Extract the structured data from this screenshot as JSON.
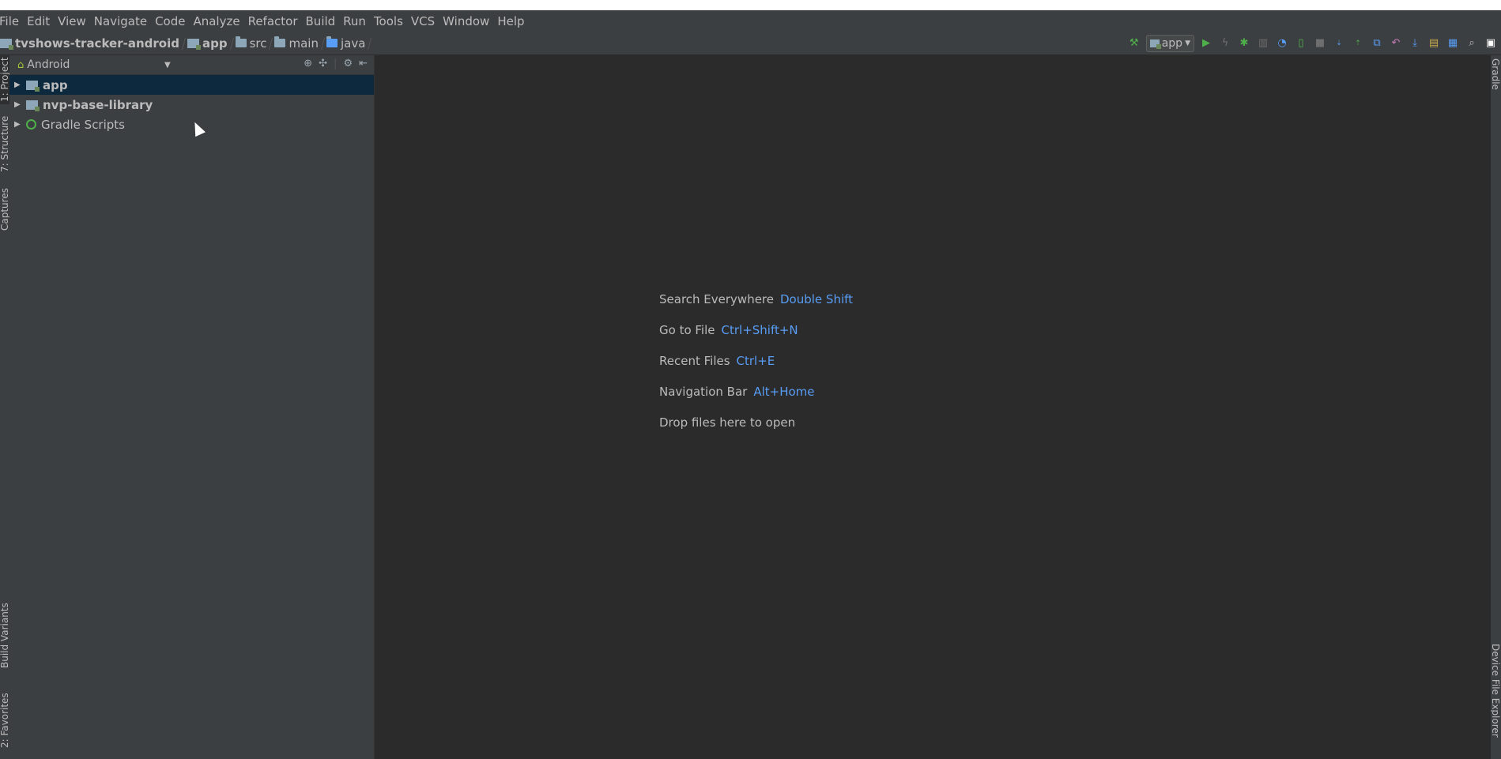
{
  "menu": [
    "File",
    "Edit",
    "View",
    "Navigate",
    "Code",
    "Analyze",
    "Refactor",
    "Build",
    "Run",
    "Tools",
    "VCS",
    "Window",
    "Help"
  ],
  "breadcrumbs": [
    "tvshows-tracker-android",
    "app",
    "src",
    "main",
    "java"
  ],
  "toolbar": {
    "run_config": "app"
  },
  "project_panel": {
    "view_mode": "Android",
    "tree": [
      {
        "label": "app",
        "bold": true,
        "selected": true
      },
      {
        "label": "nvp-base-library",
        "bold": true,
        "selected": false
      },
      {
        "label": "Gradle Scripts",
        "bold": false,
        "selected": false
      }
    ]
  },
  "left_tool_windows": [
    "1: Project",
    "7: Structure",
    "Captures",
    "Build Variants",
    "2: Favorites"
  ],
  "right_tool_windows": [
    "Gradle",
    "Device File Explorer"
  ],
  "editor_hints": [
    {
      "label": "Search Everywhere",
      "shortcut": "Double Shift"
    },
    {
      "label": "Go to File",
      "shortcut": "Ctrl+Shift+N"
    },
    {
      "label": "Recent Files",
      "shortcut": "Ctrl+E"
    },
    {
      "label": "Navigation Bar",
      "shortcut": "Alt+Home"
    },
    {
      "label": "Drop files here to open",
      "shortcut": ""
    }
  ],
  "colors": {
    "background": "#2b2b2b",
    "panel": "#3c3f41",
    "selection": "#0d293e",
    "shortcut": "#589df6"
  }
}
